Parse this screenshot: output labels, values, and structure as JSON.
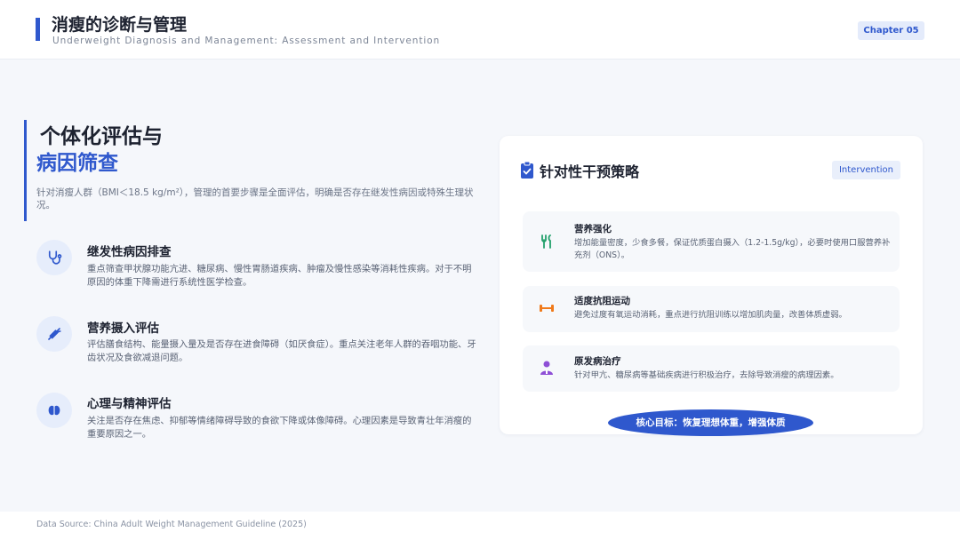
{
  "header": {
    "title": "消瘦的诊断与管理",
    "subtitle": "Underweight Diagnosis and Management: Assessment and Intervention",
    "chapter": "Chapter 05"
  },
  "left": {
    "title_line1": "个体化评估与",
    "title_line2": "病因筛查",
    "intro": "针对消瘦人群（BMI＜18.5 kg/m²），管理的首要步骤是全面评估，明确是否存在继发性病因或特殊生理状况。",
    "items": [
      {
        "icon": "stethoscope-icon",
        "title": "继发性病因排查",
        "desc": "重点筛查甲状腺功能亢进、糖尿病、慢性胃肠道疾病、肿瘤及慢性感染等消耗性疾病。对于不明原因的体重下降需进行系统性医学检查。"
      },
      {
        "icon": "carrot-icon",
        "title": "营养摄入评估",
        "desc": "评估膳食结构、能量摄入量及是否存在进食障碍（如厌食症）。重点关注老年人群的吞咽功能、牙齿状况及食欲减退问题。"
      },
      {
        "icon": "brain-icon",
        "title": "心理与精神评估",
        "desc": "关注是否存在焦虑、抑郁等情绪障碍导致的食欲下降或体像障碍。心理因素是导致青壮年消瘦的重要原因之一。"
      }
    ]
  },
  "card": {
    "title": "针对性干预策略",
    "tag": "Intervention",
    "strategies": [
      {
        "icon": "utensils-icon",
        "color": "#22a06b",
        "title": "营养强化",
        "desc": "增加能量密度，少食多餐，保证优质蛋白摄入（1.2-1.5g/kg），必要时使用口服营养补充剂（ONS）。"
      },
      {
        "icon": "dumbbell-icon",
        "color": "#f07a1a",
        "title": "适度抗阻运动",
        "desc": "避免过度有氧运动消耗，重点进行抗阻训练以增加肌肉量，改善体质虚弱。"
      },
      {
        "icon": "doctor-icon",
        "color": "#8e4fd6",
        "title": "原发病治疗",
        "desc": "针对甲亢、糖尿病等基础疾病进行积极治疗，去除导致消瘦的病理因素。"
      }
    ],
    "goal": "核心目标：恢复理想体重，增强体质"
  },
  "footer": {
    "source": "Data Source: China Adult Weight Management Guideline (2025)"
  },
  "colors": {
    "accent": "#2f58cd",
    "background": "#f5f7fb"
  }
}
